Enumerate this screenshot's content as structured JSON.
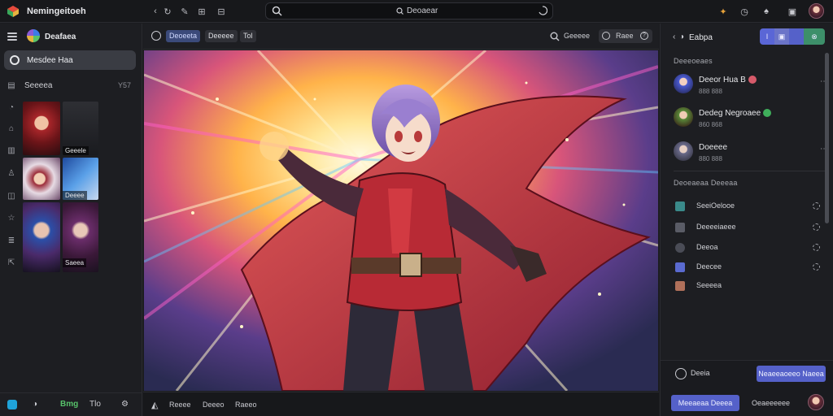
{
  "app": {
    "title": "Nemingeitoeh"
  },
  "search": {
    "text": "Deoaear"
  },
  "sidebar": {
    "brand": "Deafaea",
    "active_item": "Mesdee Haa",
    "row_label": "Seeeea",
    "row_count": "Y57",
    "thumbs": [
      "Geeele",
      "Deeee",
      "Saeea"
    ],
    "bottom": [
      "Bmg",
      "Tlo"
    ]
  },
  "center": {
    "toolbar": {
      "chips": [
        "Deoeeta",
        "Deeeee",
        "Tol"
      ],
      "search_label": "Geeeee",
      "right_chip": "Raee"
    },
    "bottom": [
      "Reeee",
      "Deeeo",
      "Raeeo"
    ]
  },
  "right": {
    "header_label": "Eabpa",
    "section_1": "Deeeoeaes",
    "contacts": [
      {
        "name": "Deeor Hua B",
        "sub": "888 888",
        "badge_color": "#d65a6a"
      },
      {
        "name": "Dedeg Negroaee",
        "sub": "860 868",
        "badge_color": "#3fae5b"
      },
      {
        "name": "Doeeee",
        "sub": "880 888",
        "badge_color": ""
      }
    ],
    "section_2": "Deoeaeaa Deeeaa",
    "list": [
      "SeeiOelooe",
      "Deeeeiaeee",
      "Deeoa",
      "Deecee",
      "Seeeea"
    ],
    "footer": {
      "item": "Deeia",
      "primary": "Neaeeaoeeo Naeea",
      "secondary_btn": "Meeaeaa Deeea",
      "secondary_text": "Oeaeeeeee"
    }
  },
  "colors": {
    "accent": "#5561c9",
    "panel": "#1d1e22",
    "bar": "#17181b"
  }
}
